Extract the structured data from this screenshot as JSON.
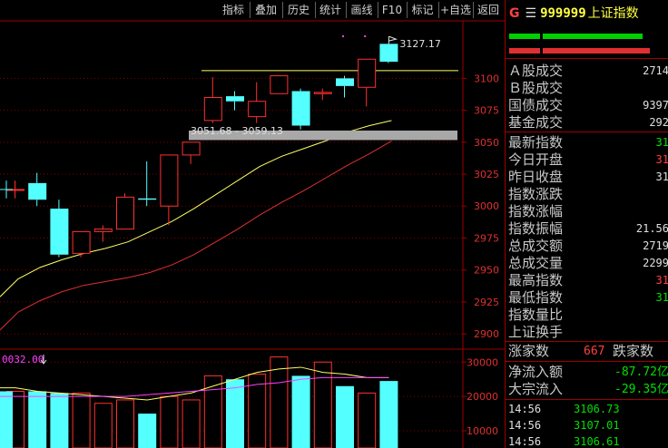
{
  "toolbar": {
    "items": [
      {
        "label": "指标"
      },
      {
        "label": "叠加"
      },
      {
        "label": "历史"
      },
      {
        "label": "统计"
      },
      {
        "label": "画线"
      },
      {
        "label": "F10"
      },
      {
        "label": "标记"
      },
      {
        "label": "+自选"
      },
      {
        "label": "返回"
      }
    ]
  },
  "chart": {
    "price_axis_ticks": [
      "3100",
      "3075",
      "3050",
      "3025",
      "3000",
      "2975",
      "2950",
      "2925",
      "2900"
    ],
    "annotation_high": "3127.17",
    "gap_label": "3051.68 - 3059.13",
    "volume_label": "0032.00",
    "volume_axis_ticks": [
      "30000",
      "20000",
      "10000"
    ]
  },
  "chart_data": {
    "type": "candlestick",
    "price_ylim": [
      2888,
      3145
    ],
    "volume_ylim": [
      5000,
      33500
    ],
    "candles": [
      {
        "open": 3013,
        "high": 3020,
        "low": 3006,
        "close": 3013
      },
      {
        "open": 3018,
        "high": 3026,
        "low": 3000,
        "close": 3005
      },
      {
        "open": 2998,
        "high": 3005,
        "low": 2960,
        "close": 2962
      },
      {
        "open": 2963,
        "high": 2980,
        "low": 2960,
        "close": 2980
      },
      {
        "open": 2980,
        "high": 2985,
        "low": 2972,
        "close": 2982
      },
      {
        "open": 2982,
        "high": 3010,
        "low": 2982,
        "close": 3007
      },
      {
        "open": 3006,
        "high": 3035,
        "low": 3000,
        "close": 3005
      },
      {
        "open": 3000,
        "high": 3040,
        "low": 2985,
        "close": 3040
      },
      {
        "open": 3040,
        "high": 3050,
        "low": 3033,
        "close": 3050
      },
      {
        "open": 3067,
        "high": 3101,
        "low": 3065,
        "close": 3085
      },
      {
        "open": 3086,
        "high": 3090,
        "low": 3075,
        "close": 3082
      },
      {
        "open": 3070,
        "high": 3097,
        "low": 3065,
        "close": 3082
      },
      {
        "open": 3088,
        "high": 3102,
        "low": 3088,
        "close": 3102
      },
      {
        "open": 3090,
        "high": 3092,
        "low": 3060,
        "close": 3063
      },
      {
        "open": 3088,
        "high": 3092,
        "low": 3083,
        "close": 3089
      },
      {
        "open": 3100,
        "high": 3102,
        "low": 3085,
        "close": 3094
      },
      {
        "open": 3093,
        "high": 3115,
        "low": 3078,
        "close": 3115
      },
      {
        "open": 3127,
        "high": 3127.17,
        "low": 3112,
        "close": 3113
      }
    ],
    "ma_yellow": [
      2943,
      2952,
      2958,
      2963,
      2967,
      2972,
      2980,
      2988,
      2998,
      3009,
      3020,
      3031,
      3039,
      3045,
      3051,
      3058,
      3063,
      3067
    ],
    "ma_red": [
      2917,
      2926,
      2933,
      2938,
      2941,
      2944,
      2948,
      2954,
      2962,
      2972,
      2982,
      2993,
      3003,
      3012,
      3022,
      3032,
      3041,
      3051
    ],
    "volumes": [
      21500,
      21500,
      21000,
      21000,
      18000,
      19000,
      15000,
      20000,
      19000,
      26000,
      25000,
      26500,
      31500,
      26000,
      30000,
      23000,
      21000,
      24500
    ],
    "vol_ma_1": [
      22500,
      21500,
      21000,
      20500,
      20000,
      19500,
      19000,
      20000,
      21000,
      23000,
      25000,
      27000,
      28000,
      28500,
      27000,
      26500,
      25500,
      25500
    ],
    "vol_ma_2": [
      20000,
      20000,
      20000,
      20000,
      20000,
      20000,
      20500,
      21000,
      21500,
      22000,
      22500,
      23500,
      24000,
      25000,
      25500,
      25500,
      25500,
      25500
    ],
    "gap_zone": [
      3051.68,
      3059.13
    ],
    "high_line": 3106
  },
  "panel": {
    "g_label": "G",
    "menu_icon": "hamburger-icon",
    "code": "999999",
    "name": "上证指数",
    "rows": [
      {
        "label": "Ａ股成交",
        "value": "2714",
        "color": "#e0e0e0"
      },
      {
        "label": "Ｂ股成交",
        "value": "",
        "color": "#e0e0e0"
      },
      {
        "label": "国债成交",
        "value": "9397",
        "color": "#e0e0e0"
      },
      {
        "label": "基金成交",
        "value": "292",
        "color": "#e0e0e0"
      },
      {
        "label": "最新指数",
        "value": "31",
        "color": "#00e000"
      },
      {
        "label": "今日开盘",
        "value": "31",
        "color": "#ff4040"
      },
      {
        "label": "昨日收盘",
        "value": "31",
        "color": "#e0e0e0"
      },
      {
        "label": "指数涨跌",
        "value": "",
        "color": "#00e000"
      },
      {
        "label": "指数涨幅",
        "value": "",
        "color": "#00e000"
      },
      {
        "label": "指数振幅",
        "value": "21.56",
        "color": "#e0e0e0"
      },
      {
        "label": "总成交额",
        "value": "2719",
        "color": "#e0e0e0"
      },
      {
        "label": "总成交量",
        "value": "2299",
        "color": "#e0e0e0"
      },
      {
        "label": "最高指数",
        "value": "31",
        "color": "#ff4040"
      },
      {
        "label": "最低指数",
        "value": "31",
        "color": "#00e000"
      },
      {
        "label": "指数量比",
        "value": "",
        "color": "#e0e0e0"
      },
      {
        "label": "上证换手",
        "value": "",
        "color": "#e0e0e0"
      }
    ],
    "rise_label": "涨家数",
    "rise_value": "667",
    "fall_label": "跌家数",
    "net_inflow_label": "净流入额",
    "net_inflow_value": "-87.72亿",
    "block_label": "大宗流入",
    "block_value": "-29.35亿",
    "ticks": [
      {
        "time": "14:56",
        "price": "3106.73"
      },
      {
        "time": "14:56",
        "price": "3107.01"
      },
      {
        "time": "14:56",
        "price": "3106.61"
      }
    ]
  },
  "colors": {
    "up": "#ff3030",
    "down": "#54ffff",
    "ma_yellow": "#ffff66",
    "ma_red": "#e03030",
    "gap": "#a0a0a0",
    "grid": "#800000"
  }
}
